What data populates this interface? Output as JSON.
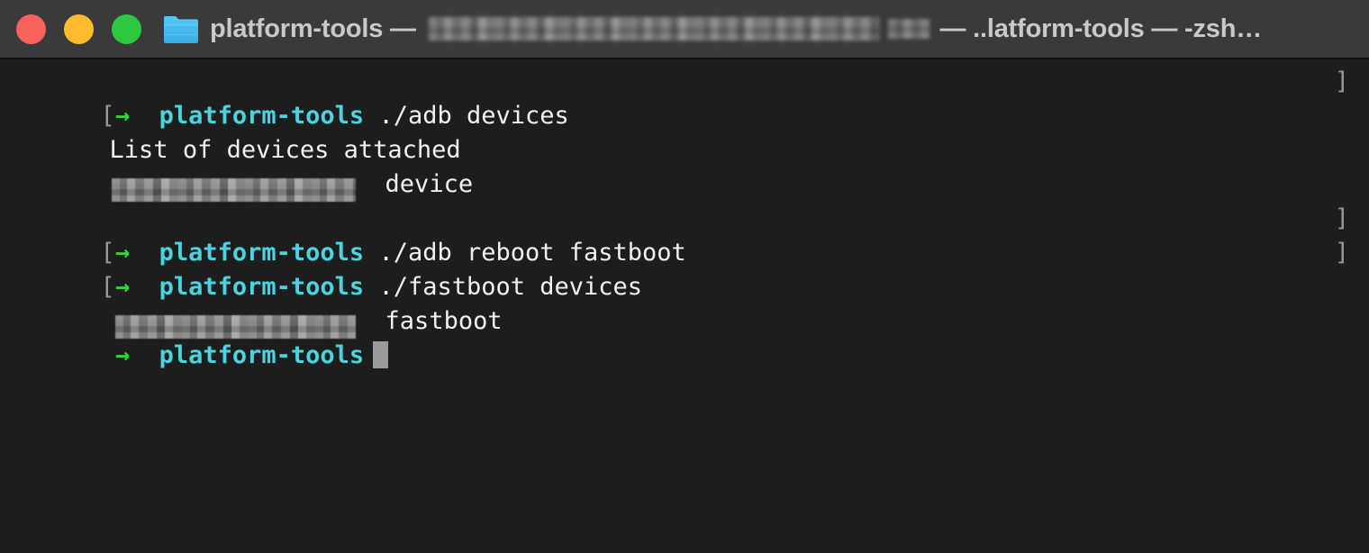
{
  "window": {
    "app": "Terminal",
    "traffic_lights": [
      {
        "name": "close",
        "color": "#f9625c"
      },
      {
        "name": "minimize",
        "color": "#febb2e"
      },
      {
        "name": "zoom",
        "color": "#2bc840"
      }
    ],
    "title": {
      "folder_icon": "folder-icon",
      "prefix": "platform-tools",
      "separator_1": " — ",
      "redacted_path": "[redacted]",
      "separator_2": " — ",
      "shortened_path": "..latform-tools",
      "separator_3": " — ",
      "shell": "-zsh…",
      "full_text": "platform-tools — [redacted] — ..latform-tools — -zsh…"
    }
  },
  "theme": {
    "titlebar_bg": "#3a3a3a",
    "terminal_bg": "#1d1d1d",
    "text": "#f2f2f2",
    "prompt_path": "#4ad4e0",
    "prompt_arrow": "#34d43a",
    "bracket": "#9a9a9a",
    "cursor": "#9a9a9a"
  },
  "terminal": {
    "prompt": {
      "bracket_open": "[",
      "arrow": "→",
      "path": "platform-tools",
      "bracket_close": "]"
    },
    "cursor_char": "▌",
    "lines": [
      {
        "type": "prompt",
        "bracket_open": "[",
        "arrow": "→",
        "path": "platform-tools",
        "command": "./adb devices",
        "bracket_close": "]"
      },
      {
        "type": "output",
        "text": "List of devices attached"
      },
      {
        "type": "output-redacted",
        "redacted": "[device-serial-redacted]",
        "text": "device"
      },
      {
        "type": "blank",
        "text": " "
      },
      {
        "type": "prompt",
        "bracket_open": "[",
        "arrow": "→",
        "path": "platform-tools",
        "command": "./adb reboot fastboot",
        "bracket_close": "]"
      },
      {
        "type": "prompt",
        "bracket_open": "[",
        "arrow": "→",
        "path": "platform-tools",
        "command": "./fastboot devices",
        "bracket_close": "]"
      },
      {
        "type": "output-redacted",
        "redacted": "[device-serial-redacted]",
        "text": "fastboot"
      },
      {
        "type": "prompt-active",
        "arrow": "→",
        "path": "platform-tools",
        "command": ""
      }
    ]
  }
}
